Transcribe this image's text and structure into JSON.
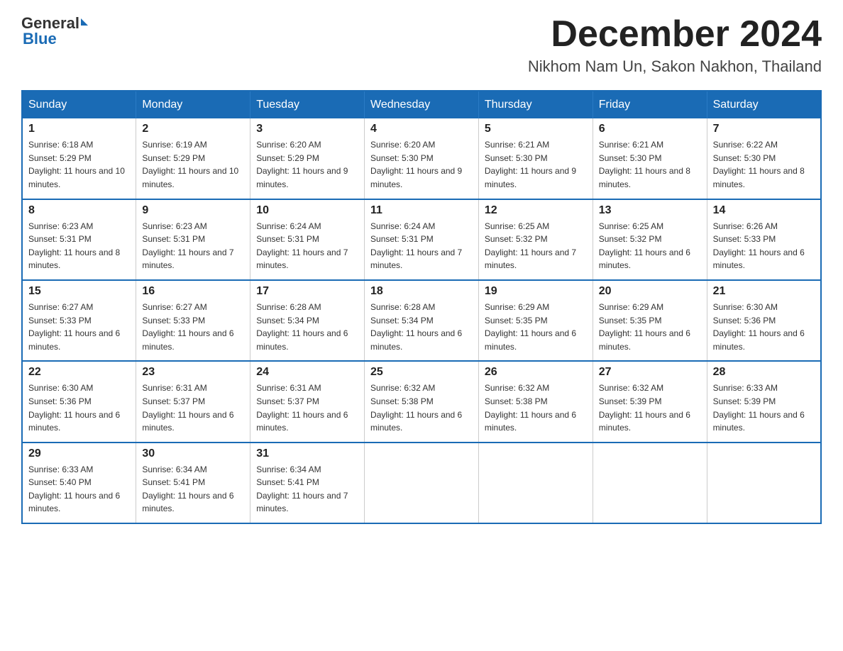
{
  "logo": {
    "general": "General",
    "blue": "Blue"
  },
  "title": {
    "month": "December 2024",
    "location": "Nikhom Nam Un, Sakon Nakhon, Thailand"
  },
  "weekdays": [
    "Sunday",
    "Monday",
    "Tuesday",
    "Wednesday",
    "Thursday",
    "Friday",
    "Saturday"
  ],
  "weeks": [
    [
      {
        "day": "1",
        "sunrise": "6:18 AM",
        "sunset": "5:29 PM",
        "daylight": "11 hours and 10 minutes."
      },
      {
        "day": "2",
        "sunrise": "6:19 AM",
        "sunset": "5:29 PM",
        "daylight": "11 hours and 10 minutes."
      },
      {
        "day": "3",
        "sunrise": "6:20 AM",
        "sunset": "5:29 PM",
        "daylight": "11 hours and 9 minutes."
      },
      {
        "day": "4",
        "sunrise": "6:20 AM",
        "sunset": "5:30 PM",
        "daylight": "11 hours and 9 minutes."
      },
      {
        "day": "5",
        "sunrise": "6:21 AM",
        "sunset": "5:30 PM",
        "daylight": "11 hours and 9 minutes."
      },
      {
        "day": "6",
        "sunrise": "6:21 AM",
        "sunset": "5:30 PM",
        "daylight": "11 hours and 8 minutes."
      },
      {
        "day": "7",
        "sunrise": "6:22 AM",
        "sunset": "5:30 PM",
        "daylight": "11 hours and 8 minutes."
      }
    ],
    [
      {
        "day": "8",
        "sunrise": "6:23 AM",
        "sunset": "5:31 PM",
        "daylight": "11 hours and 8 minutes."
      },
      {
        "day": "9",
        "sunrise": "6:23 AM",
        "sunset": "5:31 PM",
        "daylight": "11 hours and 7 minutes."
      },
      {
        "day": "10",
        "sunrise": "6:24 AM",
        "sunset": "5:31 PM",
        "daylight": "11 hours and 7 minutes."
      },
      {
        "day": "11",
        "sunrise": "6:24 AM",
        "sunset": "5:31 PM",
        "daylight": "11 hours and 7 minutes."
      },
      {
        "day": "12",
        "sunrise": "6:25 AM",
        "sunset": "5:32 PM",
        "daylight": "11 hours and 7 minutes."
      },
      {
        "day": "13",
        "sunrise": "6:25 AM",
        "sunset": "5:32 PM",
        "daylight": "11 hours and 6 minutes."
      },
      {
        "day": "14",
        "sunrise": "6:26 AM",
        "sunset": "5:33 PM",
        "daylight": "11 hours and 6 minutes."
      }
    ],
    [
      {
        "day": "15",
        "sunrise": "6:27 AM",
        "sunset": "5:33 PM",
        "daylight": "11 hours and 6 minutes."
      },
      {
        "day": "16",
        "sunrise": "6:27 AM",
        "sunset": "5:33 PM",
        "daylight": "11 hours and 6 minutes."
      },
      {
        "day": "17",
        "sunrise": "6:28 AM",
        "sunset": "5:34 PM",
        "daylight": "11 hours and 6 minutes."
      },
      {
        "day": "18",
        "sunrise": "6:28 AM",
        "sunset": "5:34 PM",
        "daylight": "11 hours and 6 minutes."
      },
      {
        "day": "19",
        "sunrise": "6:29 AM",
        "sunset": "5:35 PM",
        "daylight": "11 hours and 6 minutes."
      },
      {
        "day": "20",
        "sunrise": "6:29 AM",
        "sunset": "5:35 PM",
        "daylight": "11 hours and 6 minutes."
      },
      {
        "day": "21",
        "sunrise": "6:30 AM",
        "sunset": "5:36 PM",
        "daylight": "11 hours and 6 minutes."
      }
    ],
    [
      {
        "day": "22",
        "sunrise": "6:30 AM",
        "sunset": "5:36 PM",
        "daylight": "11 hours and 6 minutes."
      },
      {
        "day": "23",
        "sunrise": "6:31 AM",
        "sunset": "5:37 PM",
        "daylight": "11 hours and 6 minutes."
      },
      {
        "day": "24",
        "sunrise": "6:31 AM",
        "sunset": "5:37 PM",
        "daylight": "11 hours and 6 minutes."
      },
      {
        "day": "25",
        "sunrise": "6:32 AM",
        "sunset": "5:38 PM",
        "daylight": "11 hours and 6 minutes."
      },
      {
        "day": "26",
        "sunrise": "6:32 AM",
        "sunset": "5:38 PM",
        "daylight": "11 hours and 6 minutes."
      },
      {
        "day": "27",
        "sunrise": "6:32 AM",
        "sunset": "5:39 PM",
        "daylight": "11 hours and 6 minutes."
      },
      {
        "day": "28",
        "sunrise": "6:33 AM",
        "sunset": "5:39 PM",
        "daylight": "11 hours and 6 minutes."
      }
    ],
    [
      {
        "day": "29",
        "sunrise": "6:33 AM",
        "sunset": "5:40 PM",
        "daylight": "11 hours and 6 minutes."
      },
      {
        "day": "30",
        "sunrise": "6:34 AM",
        "sunset": "5:41 PM",
        "daylight": "11 hours and 6 minutes."
      },
      {
        "day": "31",
        "sunrise": "6:34 AM",
        "sunset": "5:41 PM",
        "daylight": "11 hours and 7 minutes."
      },
      null,
      null,
      null,
      null
    ]
  ]
}
